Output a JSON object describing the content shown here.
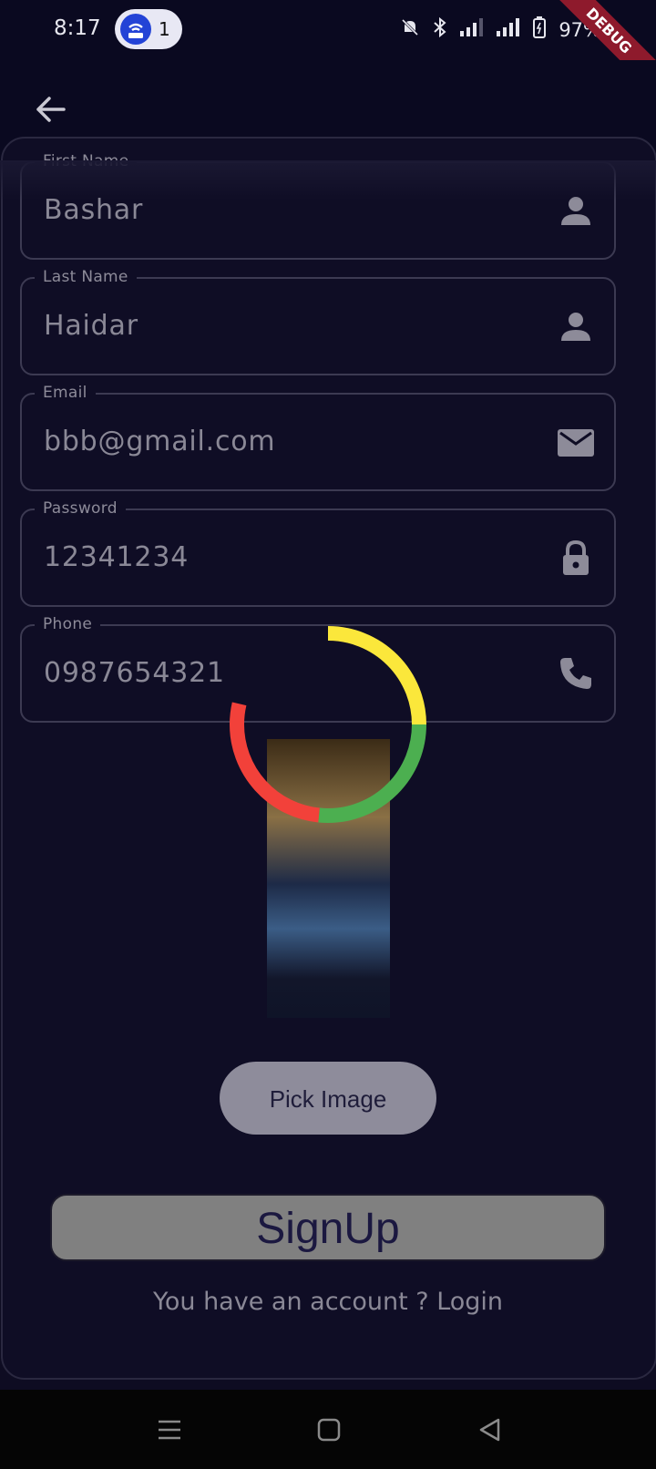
{
  "status_bar": {
    "time": "8:17",
    "notification_count": "1",
    "battery": "97%",
    "debug_banner": "DEBUG"
  },
  "form": {
    "first_name": {
      "label": "First Name",
      "value": "Bashar",
      "icon": "person-icon"
    },
    "last_name": {
      "label": "Last Name",
      "value": "Haidar",
      "icon": "person-icon"
    },
    "email": {
      "label": "Email",
      "value": "bbb@gmail.com",
      "icon": "mail-icon"
    },
    "password": {
      "label": "Password",
      "value": "12341234",
      "icon": "lock-icon"
    },
    "phone": {
      "label": "Phone",
      "value": "0987654321",
      "icon": "phone-icon"
    }
  },
  "pick_image_label": "Pick Image",
  "signup_label": "SignUp",
  "login_prompt": "You have an account ? Login",
  "colors": {
    "background": "#0e0c22",
    "ring_red": "#f2413a",
    "ring_yellow": "#fbe73b",
    "ring_green": "#4caf50"
  }
}
